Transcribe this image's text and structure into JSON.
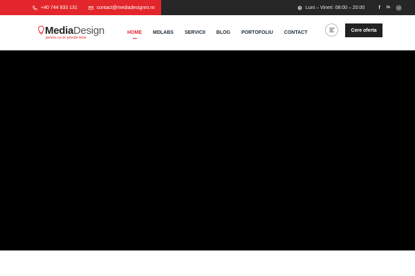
{
  "topbar": {
    "phone": "+40 744 933 131",
    "email": "contact@mediadesignro.ro",
    "hours": "Luni – Vineri: 08:00 – 20:00",
    "social": [
      "f",
      "in",
      "ig"
    ],
    "left_color": "#e3262b",
    "right_color": "#262626"
  },
  "logo": {
    "media": "Media",
    "design": "Design",
    "tagline": "pentru ca te privide bine"
  },
  "nav": {
    "items": [
      "HOME",
      "MDLABS",
      "SERVICII",
      "BLOG",
      "PORTOFOLIU",
      "CONTACT"
    ],
    "active": "HOME"
  },
  "header": {
    "cta_label": "Cere oferta"
  },
  "icons": {
    "phone": "phone-icon",
    "email": "envelope-icon",
    "hours": "clock-icon",
    "menu": "menu-lines-icon"
  },
  "colors": {
    "accent": "#e3262b",
    "dark": "#222222",
    "nav_text": "#1c2a3a"
  }
}
